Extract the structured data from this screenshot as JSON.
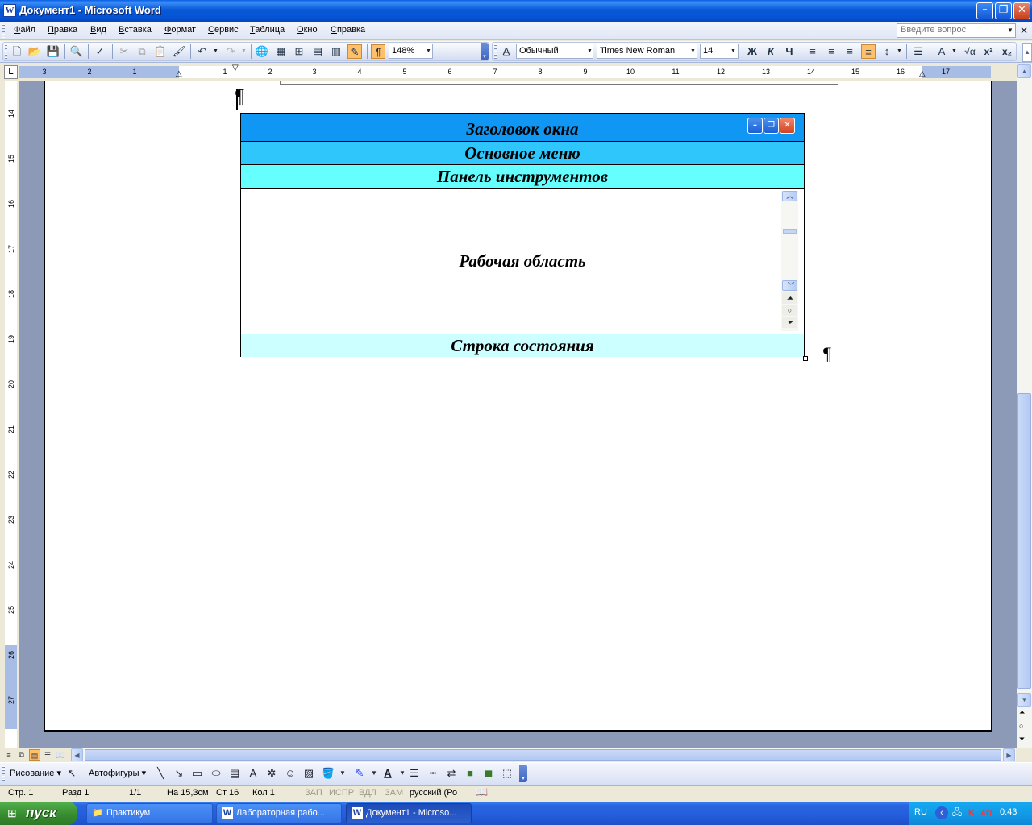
{
  "window": {
    "title": "Документ1 - Microsoft Word",
    "app_icon": "W",
    "minimize_icon": "minimize-icon",
    "restore_icon": "restore-icon",
    "close_icon": "close-icon"
  },
  "menu": {
    "items": [
      "Файл",
      "Правка",
      "Вид",
      "Вставка",
      "Формат",
      "Сервис",
      "Таблица",
      "Окно",
      "Справка"
    ],
    "help_placeholder": "Введите вопрос"
  },
  "toolbar": {
    "zoom": "148%",
    "style": "Обычный",
    "font": "Times New Roman",
    "size": "14",
    "bold": "Ж",
    "italic": "К",
    "underline": "Ч",
    "superscript": "x²",
    "subscript": "x₂",
    "pilcrow": "¶"
  },
  "ruler": {
    "corner": "L",
    "numbers": [
      "3",
      "2",
      "1",
      "1",
      "2",
      "3",
      "4",
      "5",
      "6",
      "7",
      "8",
      "9",
      "10",
      "11",
      "12",
      "13",
      "14",
      "15",
      "16",
      "17"
    ],
    "vertical_numbers": [
      "14",
      "15",
      "16",
      "17",
      "18",
      "19",
      "20",
      "21",
      "22",
      "23",
      "24",
      "25",
      "26",
      "27"
    ]
  },
  "diagram": {
    "title_bar": "Заголовок окна",
    "main_menu": "Основное меню",
    "toolbar": "Панель инструментов",
    "work_area": "Рабочая область",
    "status_bar": "Строка состояния",
    "pilcrow": "¶"
  },
  "drawing_toolbar": {
    "drawing": "Рисование",
    "autoshapes": "Автофигуры"
  },
  "status": {
    "page": "Стр. 1",
    "section": "Разд 1",
    "pages": "1/1",
    "at": "На 15,3см",
    "line": "Ст 16",
    "col": "Кол 1",
    "rec": "ЗАП",
    "trk": "ИСПР",
    "ext": "ВДЛ",
    "ovr": "ЗАМ",
    "language": "русский (Ро"
  },
  "taskbar": {
    "start": "пуск",
    "tasks": [
      {
        "label": "Практикум",
        "icon": "folder-icon"
      },
      {
        "label": "Лабораторная рабо...",
        "icon": "word-icon"
      },
      {
        "label": "Документ1 - Microso...",
        "icon": "word-icon"
      }
    ],
    "lang": "RU",
    "clock": "0:43"
  }
}
